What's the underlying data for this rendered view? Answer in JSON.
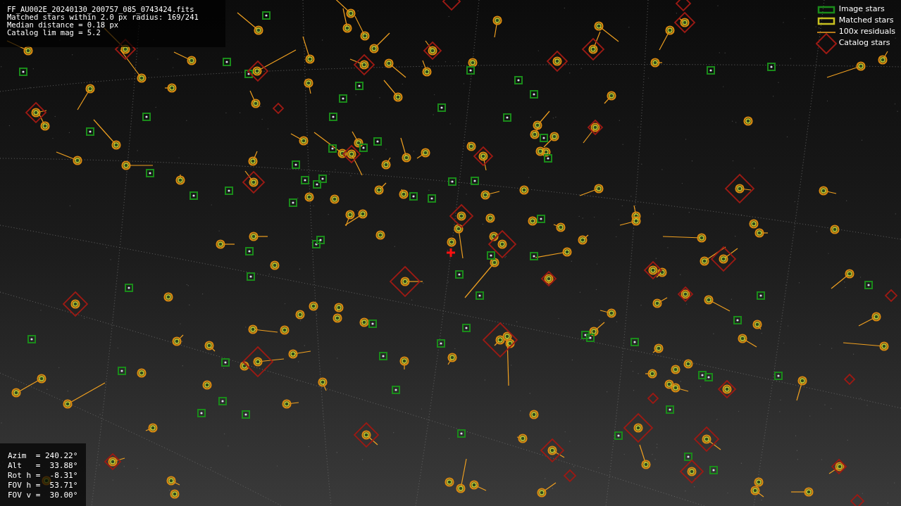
{
  "info_box": {
    "lines": [
      "FF_AU002E_20240130_200757_085_0743424.fits",
      "Matched stars within 2.0 px radius: 169/241",
      "Median distance = 0.18 px",
      "Catalog lim mag = 5.2"
    ]
  },
  "legend": [
    {
      "kind": "image",
      "label": "Image stars"
    },
    {
      "kind": "matched",
      "label": "Matched stars"
    },
    {
      "kind": "residual",
      "label": "100x residuals"
    },
    {
      "kind": "catalog",
      "label": "Catalog stars"
    }
  ],
  "pointing_box": {
    "lines": [
      "Azim  = 240.22°",
      "Alt   =  33.88°",
      "Rot h =  -8.31°",
      "FOV h =  53.71°",
      "FOV v =  30.00°"
    ]
  }
}
